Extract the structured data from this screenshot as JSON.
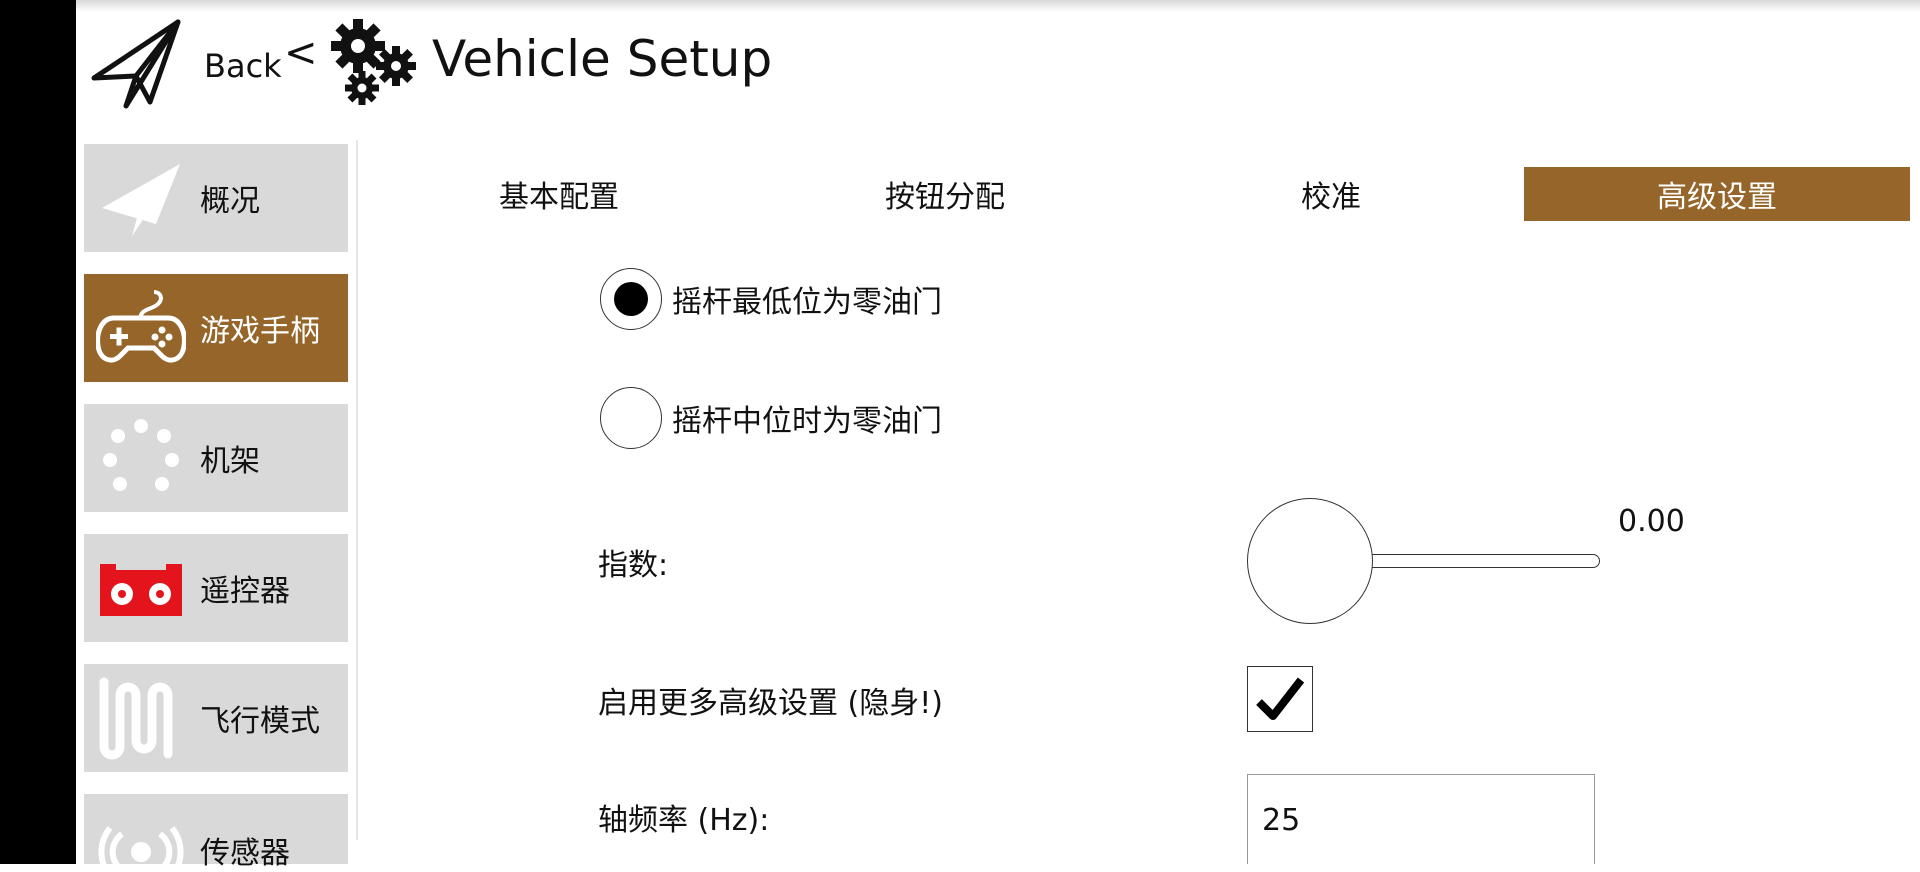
{
  "header": {
    "back_label": "Back",
    "separator": "<",
    "title": "Vehicle Setup"
  },
  "sidebar": {
    "items": [
      {
        "label": "概况",
        "icon": "paper-plane-icon",
        "active": false
      },
      {
        "label": "游戏手柄",
        "icon": "gamepad-icon",
        "active": true
      },
      {
        "label": "机架",
        "icon": "frame-dots-icon",
        "active": false
      },
      {
        "label": "遥控器",
        "icon": "remote-controller-icon",
        "active": false
      },
      {
        "label": "飞行模式",
        "icon": "flight-mode-wave-icon",
        "active": false
      },
      {
        "label": "传感器",
        "icon": "sensor-icon",
        "active": false
      }
    ]
  },
  "tabs": [
    {
      "label": "基本配置",
      "active": false
    },
    {
      "label": "按钮分配",
      "active": false
    },
    {
      "label": "校准",
      "active": false
    },
    {
      "label": "高级设置",
      "active": true
    }
  ],
  "settings": {
    "throttle_mode": {
      "options": [
        {
          "label": "摇杆最低位为零油门",
          "selected": true
        },
        {
          "label": "摇杆中位时为零油门",
          "selected": false
        }
      ]
    },
    "exponent": {
      "label": "指数:",
      "value_text": "0.00",
      "value": 0.0
    },
    "advanced_toggle": {
      "label": "启用更多高级设置 (隐身!)",
      "checked": true
    },
    "axis_frequency": {
      "label": "轴频率 (Hz):",
      "value": "25"
    }
  },
  "colors": {
    "accent": "#95652a",
    "sidebar_bg": "#d9d9d9",
    "left_bar": "#000000",
    "remote_icon_red": "#e3141b"
  }
}
